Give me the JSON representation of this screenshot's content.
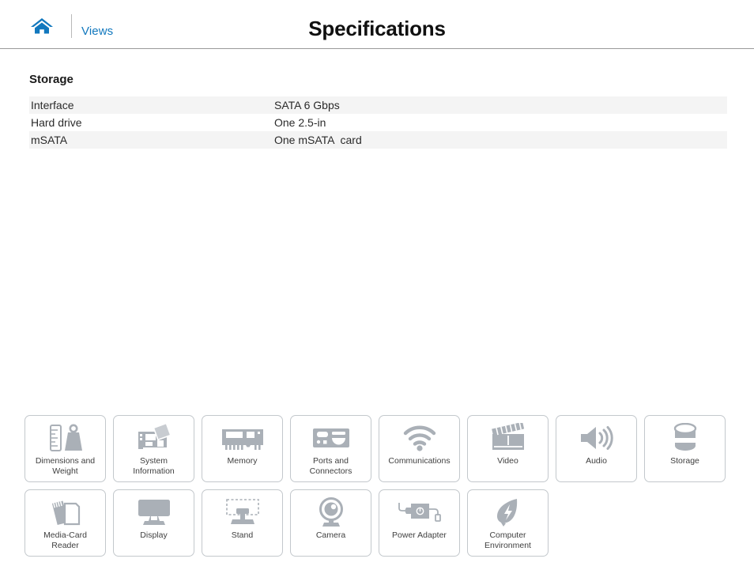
{
  "header": {
    "home_icon": "home-icon",
    "views_label": "Views",
    "title": "Specifications"
  },
  "main": {
    "section_title": "Storage",
    "table": {
      "rows": [
        {
          "key": "Interface",
          "value": "SATA 6 Gbps"
        },
        {
          "key": "Hard drive",
          "value": "One 2.5-in"
        },
        {
          "key": "mSATA",
          "value": "One mSATA  card"
        }
      ]
    }
  },
  "icon_grid": {
    "rows": [
      [
        {
          "label": "Dimensions and\nWeight",
          "icon": "ruler-weight-icon"
        },
        {
          "label": "System\nInformation",
          "icon": "motherboard-icon"
        },
        {
          "label": "Memory",
          "icon": "memory-module-icon"
        },
        {
          "label": "Ports and\nConnectors",
          "icon": "ports-icon"
        },
        {
          "label": "Communications",
          "icon": "wifi-icon"
        },
        {
          "label": "Video",
          "icon": "clapperboard-icon"
        },
        {
          "label": "Audio",
          "icon": "speaker-icon"
        },
        {
          "label": "Storage",
          "icon": "drive-cylinder-icon"
        }
      ],
      [
        {
          "label": "Media-Card\nReader",
          "icon": "memory-card-icon"
        },
        {
          "label": "Display",
          "icon": "monitor-icon"
        },
        {
          "label": "Stand",
          "icon": "stand-icon"
        },
        {
          "label": "Camera",
          "icon": "webcam-icon"
        },
        {
          "label": "Power Adapter",
          "icon": "power-adapter-icon"
        },
        {
          "label": "Computer\nEnvironment",
          "icon": "leaf-bolt-icon"
        }
      ]
    ]
  },
  "colors": {
    "link": "#1278be",
    "home_icon": "#1278be",
    "icon_fill": "#aab0b7",
    "card_border": "#c3c8cc",
    "row_stripe": "#f4f4f4"
  }
}
